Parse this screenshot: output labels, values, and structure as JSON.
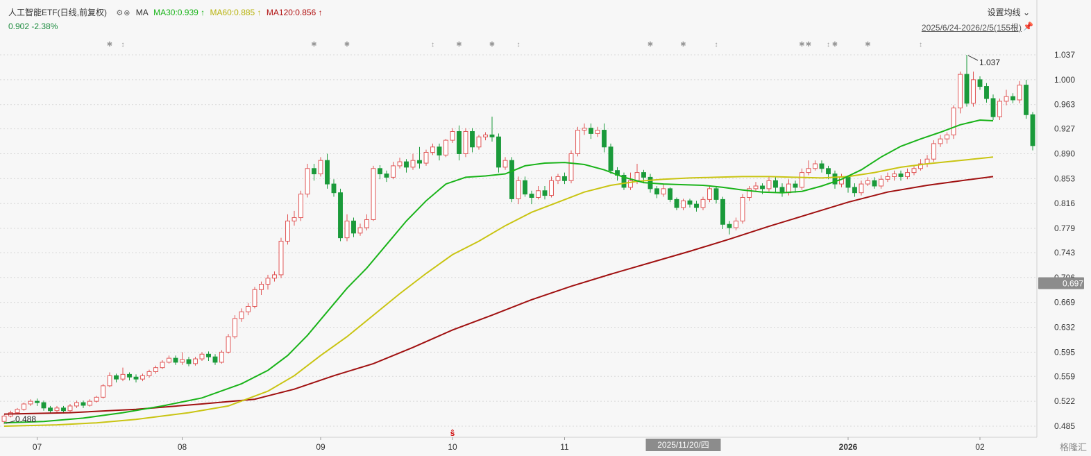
{
  "header": {
    "title": "人工智能ETF(日线,前复权)",
    "ma_label": "MA",
    "ma30": "MA30:0.939 ↑",
    "ma60": "MA60:0.885 ↑",
    "ma120": "MA120:0.856 ↑",
    "price_change": "0.902 -2.38%",
    "settings": "设置均线",
    "date_range": "2025/6/24-2026/2/5(155根)",
    "watermark": "格隆汇"
  },
  "colors": {
    "up": "#e05555",
    "down": "#1a9a3a",
    "ma30": "#19b319",
    "ma60": "#c9c412",
    "ma120": "#a01010",
    "grid": "#d9d9d9",
    "axis_text": "#333333",
    "highlight_bg": "#8c8c8c"
  },
  "chart_data": {
    "type": "candlestick",
    "y_ticks": [
      "1.037",
      "1.000",
      "0.963",
      "0.927",
      "0.890",
      "0.853",
      "0.816",
      "0.779",
      "0.743",
      "0.706",
      "0.669",
      "0.632",
      "0.595",
      "0.559",
      "0.522",
      "0.485"
    ],
    "y_min": 0.485,
    "y_max": 1.037,
    "x_range": [
      0,
      154
    ],
    "x_ticks": [
      {
        "index": 5,
        "label": "07"
      },
      {
        "index": 27,
        "label": "08"
      },
      {
        "index": 48,
        "label": "09"
      },
      {
        "index": 68,
        "label": "10"
      },
      {
        "index": 85,
        "label": "11"
      },
      {
        "index": 128,
        "label": "2026"
      },
      {
        "index": 148,
        "label": "02"
      }
    ],
    "highlight_price": "0.697",
    "highlight_date": "2025/11/20/四",
    "highlight_index": 103,
    "max_label": "1.037",
    "min_label": "0.488",
    "event_marker_ticks": [
      16,
      18,
      47,
      52,
      65,
      69,
      74,
      78,
      98,
      103,
      108,
      121,
      122,
      125,
      126,
      131,
      139
    ],
    "marker_s_index": 68,
    "candles": [
      [
        0.492,
        0.5,
        0.488,
        0.502
      ],
      [
        0.5,
        0.505,
        0.498,
        0.508
      ],
      [
        0.505,
        0.51,
        0.503,
        0.512
      ],
      [
        0.51,
        0.518,
        0.508,
        0.52
      ],
      [
        0.518,
        0.522,
        0.515,
        0.525
      ],
      [
        0.522,
        0.52,
        0.515,
        0.526
      ],
      [
        0.52,
        0.512,
        0.508,
        0.523
      ],
      [
        0.512,
        0.508,
        0.505,
        0.515
      ],
      [
        0.508,
        0.512,
        0.505,
        0.515
      ],
      [
        0.512,
        0.508,
        0.504,
        0.515
      ],
      [
        0.508,
        0.515,
        0.506,
        0.518
      ],
      [
        0.515,
        0.52,
        0.512,
        0.523
      ],
      [
        0.52,
        0.516,
        0.512,
        0.523
      ],
      [
        0.516,
        0.522,
        0.514,
        0.525
      ],
      [
        0.522,
        0.528,
        0.52,
        0.53
      ],
      [
        0.528,
        0.545,
        0.526,
        0.548
      ],
      [
        0.545,
        0.56,
        0.543,
        0.565
      ],
      [
        0.56,
        0.555,
        0.55,
        0.563
      ],
      [
        0.555,
        0.562,
        0.552,
        0.572
      ],
      [
        0.562,
        0.558,
        0.553,
        0.565
      ],
      [
        0.558,
        0.555,
        0.55,
        0.562
      ],
      [
        0.555,
        0.56,
        0.552,
        0.563
      ],
      [
        0.56,
        0.566,
        0.557,
        0.569
      ],
      [
        0.566,
        0.572,
        0.563,
        0.575
      ],
      [
        0.572,
        0.58,
        0.57,
        0.583
      ],
      [
        0.58,
        0.586,
        0.578,
        0.59
      ],
      [
        0.586,
        0.58,
        0.576,
        0.59
      ],
      [
        0.58,
        0.584,
        0.576,
        0.595
      ],
      [
        0.584,
        0.578,
        0.574,
        0.588
      ],
      [
        0.578,
        0.585,
        0.575,
        0.588
      ],
      [
        0.585,
        0.592,
        0.582,
        0.595
      ],
      [
        0.592,
        0.588,
        0.582,
        0.596
      ],
      [
        0.588,
        0.58,
        0.576,
        0.592
      ],
      [
        0.58,
        0.595,
        0.578,
        0.598
      ],
      [
        0.595,
        0.618,
        0.593,
        0.622
      ],
      [
        0.618,
        0.645,
        0.615,
        0.65
      ],
      [
        0.645,
        0.655,
        0.64,
        0.66
      ],
      [
        0.655,
        0.663,
        0.65,
        0.668
      ],
      [
        0.663,
        0.688,
        0.66,
        0.692
      ],
      [
        0.688,
        0.696,
        0.68,
        0.7
      ],
      [
        0.696,
        0.705,
        0.688,
        0.71
      ],
      [
        0.705,
        0.71,
        0.7,
        0.715
      ],
      [
        0.71,
        0.76,
        0.705,
        0.765
      ],
      [
        0.76,
        0.79,
        0.755,
        0.8
      ],
      [
        0.79,
        0.795,
        0.783,
        0.805
      ],
      [
        0.795,
        0.83,
        0.79,
        0.835
      ],
      [
        0.83,
        0.868,
        0.825,
        0.875
      ],
      [
        0.868,
        0.86,
        0.85,
        0.875
      ],
      [
        0.86,
        0.88,
        0.856,
        0.885
      ],
      [
        0.88,
        0.845,
        0.838,
        0.89
      ],
      [
        0.845,
        0.832,
        0.826,
        0.852
      ],
      [
        0.832,
        0.765,
        0.76,
        0.838
      ],
      [
        0.765,
        0.79,
        0.76,
        0.8
      ],
      [
        0.79,
        0.772,
        0.766,
        0.795
      ],
      [
        0.772,
        0.78,
        0.768,
        0.786
      ],
      [
        0.78,
        0.792,
        0.776,
        0.8
      ],
      [
        0.792,
        0.868,
        0.79,
        0.872
      ],
      [
        0.868,
        0.86,
        0.852,
        0.873
      ],
      [
        0.86,
        0.855,
        0.848,
        0.865
      ],
      [
        0.855,
        0.872,
        0.852,
        0.878
      ],
      [
        0.872,
        0.878,
        0.868,
        0.884
      ],
      [
        0.878,
        0.87,
        0.862,
        0.882
      ],
      [
        0.87,
        0.88,
        0.866,
        0.89
      ],
      [
        0.88,
        0.876,
        0.868,
        0.9
      ],
      [
        0.876,
        0.892,
        0.872,
        0.896
      ],
      [
        0.892,
        0.9,
        0.888,
        0.905
      ],
      [
        0.9,
        0.888,
        0.88,
        0.905
      ],
      [
        0.888,
        0.91,
        0.885,
        0.912
      ],
      [
        0.91,
        0.923,
        0.906,
        0.928
      ],
      [
        0.923,
        0.89,
        0.88,
        0.932
      ],
      [
        0.89,
        0.923,
        0.885,
        0.928
      ],
      [
        0.923,
        0.9,
        0.892,
        0.928
      ],
      [
        0.9,
        0.915,
        0.896,
        0.918
      ],
      [
        0.915,
        0.918,
        0.91,
        0.922
      ],
      [
        0.918,
        0.915,
        0.908,
        0.945
      ],
      [
        0.915,
        0.87,
        0.862,
        0.92
      ],
      [
        0.87,
        0.88,
        0.866,
        0.885
      ],
      [
        0.88,
        0.823,
        0.818,
        0.885
      ],
      [
        0.823,
        0.85,
        0.815,
        0.856
      ],
      [
        0.85,
        0.83,
        0.826,
        0.856
      ],
      [
        0.83,
        0.825,
        0.815,
        0.835
      ],
      [
        0.825,
        0.835,
        0.822,
        0.842
      ],
      [
        0.835,
        0.828,
        0.822,
        0.842
      ],
      [
        0.828,
        0.85,
        0.825,
        0.856
      ],
      [
        0.85,
        0.856,
        0.845,
        0.86
      ],
      [
        0.856,
        0.85,
        0.845,
        0.862
      ],
      [
        0.85,
        0.89,
        0.846,
        0.895
      ],
      [
        0.89,
        0.925,
        0.886,
        0.93
      ],
      [
        0.925,
        0.928,
        0.918,
        0.935
      ],
      [
        0.928,
        0.92,
        0.912,
        0.935
      ],
      [
        0.92,
        0.925,
        0.915,
        0.93
      ],
      [
        0.925,
        0.9,
        0.892,
        0.935
      ],
      [
        0.9,
        0.865,
        0.86,
        0.905
      ],
      [
        0.865,
        0.858,
        0.85,
        0.87
      ],
      [
        0.858,
        0.84,
        0.836,
        0.862
      ],
      [
        0.84,
        0.85,
        0.836,
        0.862
      ],
      [
        0.85,
        0.862,
        0.845,
        0.875
      ],
      [
        0.862,
        0.855,
        0.846,
        0.866
      ],
      [
        0.855,
        0.838,
        0.832,
        0.86
      ],
      [
        0.838,
        0.83,
        0.824,
        0.842
      ],
      [
        0.83,
        0.838,
        0.826,
        0.845
      ],
      [
        0.838,
        0.822,
        0.818,
        0.84
      ],
      [
        0.822,
        0.81,
        0.806,
        0.825
      ],
      [
        0.81,
        0.82,
        0.806,
        0.823
      ],
      [
        0.82,
        0.815,
        0.81,
        0.823
      ],
      [
        0.815,
        0.81,
        0.804,
        0.82
      ],
      [
        0.81,
        0.822,
        0.806,
        0.826
      ],
      [
        0.822,
        0.838,
        0.818,
        0.842
      ],
      [
        0.838,
        0.822,
        0.816,
        0.842
      ],
      [
        0.822,
        0.785,
        0.778,
        0.826
      ],
      [
        0.785,
        0.78,
        0.77,
        0.79
      ],
      [
        0.78,
        0.79,
        0.776,
        0.795
      ],
      [
        0.79,
        0.825,
        0.786,
        0.83
      ],
      [
        0.825,
        0.838,
        0.82,
        0.842
      ],
      [
        0.838,
        0.842,
        0.834,
        0.848
      ],
      [
        0.842,
        0.838,
        0.83,
        0.846
      ],
      [
        0.838,
        0.85,
        0.834,
        0.856
      ],
      [
        0.85,
        0.84,
        0.832,
        0.856
      ],
      [
        0.84,
        0.832,
        0.826,
        0.846
      ],
      [
        0.832,
        0.845,
        0.828,
        0.852
      ],
      [
        0.845,
        0.84,
        0.832,
        0.85
      ],
      [
        0.84,
        0.862,
        0.836,
        0.868
      ],
      [
        0.862,
        0.868,
        0.858,
        0.88
      ],
      [
        0.868,
        0.875,
        0.865,
        0.88
      ],
      [
        0.875,
        0.868,
        0.862,
        0.88
      ],
      [
        0.868,
        0.86,
        0.852,
        0.872
      ],
      [
        0.86,
        0.845,
        0.838,
        0.865
      ],
      [
        0.845,
        0.855,
        0.84,
        0.86
      ],
      [
        0.855,
        0.84,
        0.832,
        0.858
      ],
      [
        0.84,
        0.832,
        0.826,
        0.846
      ],
      [
        0.832,
        0.845,
        0.828,
        0.85
      ],
      [
        0.845,
        0.85,
        0.842,
        0.855
      ],
      [
        0.85,
        0.842,
        0.838,
        0.855
      ],
      [
        0.842,
        0.852,
        0.838,
        0.858
      ],
      [
        0.852,
        0.856,
        0.848,
        0.862
      ],
      [
        0.856,
        0.86,
        0.85,
        0.865
      ],
      [
        0.86,
        0.856,
        0.85,
        0.865
      ],
      [
        0.856,
        0.862,
        0.852,
        0.868
      ],
      [
        0.862,
        0.868,
        0.858,
        0.873
      ],
      [
        0.868,
        0.875,
        0.865,
        0.882
      ],
      [
        0.875,
        0.882,
        0.87,
        0.888
      ],
      [
        0.882,
        0.905,
        0.878,
        0.91
      ],
      [
        0.905,
        0.912,
        0.9,
        0.918
      ],
      [
        0.912,
        0.918,
        0.905,
        0.922
      ],
      [
        0.918,
        0.958,
        0.912,
        0.962
      ],
      [
        0.958,
        1.008,
        0.95,
        1.012
      ],
      [
        1.008,
        0.965,
        0.96,
        1.037
      ],
      [
        0.965,
        1.0,
        0.96,
        1.012
      ],
      [
        1.0,
        0.99,
        0.985,
        1.005
      ],
      [
        0.99,
        0.972,
        0.966,
        0.995
      ],
      [
        0.972,
        0.945,
        0.94,
        0.978
      ],
      [
        0.945,
        0.968,
        0.94,
        0.972
      ],
      [
        0.968,
        0.975,
        0.962,
        0.985
      ],
      [
        0.975,
        0.97,
        0.965,
        0.98
      ],
      [
        0.97,
        0.992,
        0.965,
        0.998
      ],
      [
        0.992,
        0.948,
        0.942,
        1.0
      ],
      [
        0.948,
        0.902,
        0.895,
        0.952
      ]
    ],
    "ma30_line": [
      [
        0,
        0.49
      ],
      [
        6,
        0.492
      ],
      [
        12,
        0.497
      ],
      [
        18,
        0.505
      ],
      [
        24,
        0.515
      ],
      [
        30,
        0.527
      ],
      [
        36,
        0.548
      ],
      [
        40,
        0.568
      ],
      [
        43,
        0.59
      ],
      [
        46,
        0.62
      ],
      [
        49,
        0.655
      ],
      [
        52,
        0.69
      ],
      [
        55,
        0.72
      ],
      [
        58,
        0.755
      ],
      [
        61,
        0.79
      ],
      [
        64,
        0.82
      ],
      [
        67,
        0.845
      ],
      [
        70,
        0.855
      ],
      [
        73,
        0.857
      ],
      [
        76,
        0.86
      ],
      [
        79,
        0.872
      ],
      [
        82,
        0.876
      ],
      [
        85,
        0.877
      ],
      [
        88,
        0.874
      ],
      [
        91,
        0.866
      ],
      [
        94,
        0.855
      ],
      [
        97,
        0.847
      ],
      [
        100,
        0.845
      ],
      [
        103,
        0.844
      ],
      [
        106,
        0.843
      ],
      [
        109,
        0.84
      ],
      [
        112,
        0.836
      ],
      [
        115,
        0.833
      ],
      [
        118,
        0.832
      ],
      [
        121,
        0.834
      ],
      [
        124,
        0.842
      ],
      [
        127,
        0.852
      ],
      [
        130,
        0.866
      ],
      [
        133,
        0.885
      ],
      [
        136,
        0.901
      ],
      [
        139,
        0.912
      ],
      [
        142,
        0.922
      ],
      [
        145,
        0.933
      ],
      [
        148,
        0.94
      ],
      [
        150,
        0.939
      ]
    ],
    "ma60_line": [
      [
        0,
        0.485
      ],
      [
        8,
        0.487
      ],
      [
        14,
        0.49
      ],
      [
        20,
        0.495
      ],
      [
        28,
        0.505
      ],
      [
        34,
        0.515
      ],
      [
        40,
        0.537
      ],
      [
        44,
        0.56
      ],
      [
        48,
        0.59
      ],
      [
        52,
        0.618
      ],
      [
        56,
        0.65
      ],
      [
        60,
        0.682
      ],
      [
        64,
        0.712
      ],
      [
        68,
        0.74
      ],
      [
        72,
        0.76
      ],
      [
        76,
        0.783
      ],
      [
        80,
        0.803
      ],
      [
        84,
        0.818
      ],
      [
        88,
        0.833
      ],
      [
        92,
        0.843
      ],
      [
        96,
        0.849
      ],
      [
        100,
        0.852
      ],
      [
        104,
        0.854
      ],
      [
        108,
        0.855
      ],
      [
        112,
        0.856
      ],
      [
        116,
        0.856
      ],
      [
        120,
        0.855
      ],
      [
        124,
        0.854
      ],
      [
        128,
        0.856
      ],
      [
        132,
        0.862
      ],
      [
        136,
        0.87
      ],
      [
        140,
        0.875
      ],
      [
        144,
        0.879
      ],
      [
        148,
        0.883
      ],
      [
        150,
        0.885
      ]
    ],
    "ma120_line": [
      [
        0,
        0.503
      ],
      [
        10,
        0.505
      ],
      [
        20,
        0.51
      ],
      [
        30,
        0.518
      ],
      [
        38,
        0.525
      ],
      [
        44,
        0.54
      ],
      [
        50,
        0.56
      ],
      [
        56,
        0.578
      ],
      [
        62,
        0.602
      ],
      [
        68,
        0.628
      ],
      [
        74,
        0.65
      ],
      [
        80,
        0.673
      ],
      [
        86,
        0.693
      ],
      [
        92,
        0.711
      ],
      [
        98,
        0.728
      ],
      [
        104,
        0.745
      ],
      [
        110,
        0.763
      ],
      [
        116,
        0.782
      ],
      [
        122,
        0.8
      ],
      [
        128,
        0.818
      ],
      [
        134,
        0.833
      ],
      [
        140,
        0.843
      ],
      [
        146,
        0.851
      ],
      [
        150,
        0.856
      ]
    ]
  }
}
